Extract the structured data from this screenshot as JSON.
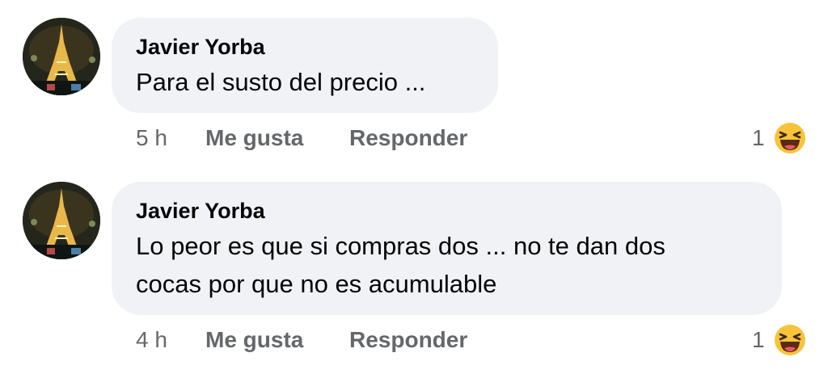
{
  "comments": [
    {
      "author": "Javier Yorba",
      "text_lines": [
        "Para el susto del precio ..."
      ],
      "time": "5 h",
      "like_label": "Me gusta",
      "reply_label": "Responder",
      "reaction_count": "1",
      "reaction_icon": "laughing-emoji-icon"
    },
    {
      "author": "Javier Yorba",
      "text_lines": [
        "Lo peor es que si compras dos ... no te dan dos",
        "cocas por que no es acumulable"
      ],
      "time": "4 h",
      "like_label": "Me gusta",
      "reply_label": "Responder",
      "reaction_count": "1",
      "reaction_icon": "laughing-emoji-icon"
    }
  ],
  "colors": {
    "bubble_bg": "#f0f2f5",
    "text": "#050505",
    "secondary_text": "#65676b",
    "emoji_yellow": "#f7c33b"
  }
}
